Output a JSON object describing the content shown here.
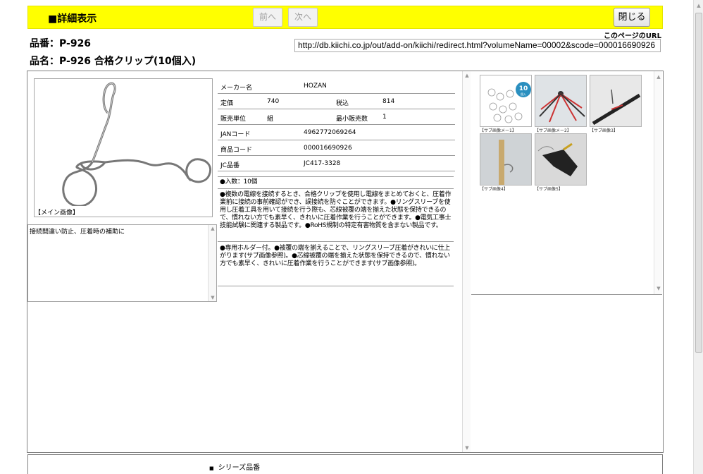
{
  "header": {
    "title": "■詳細表示",
    "prev": "前へ",
    "next": "次へ",
    "close": "閉じる"
  },
  "product": {
    "code": "品番：P-926",
    "name": "品名：P-926 合格クリップ(10個入)"
  },
  "url": {
    "label": "このページのURL",
    "value": "http://db.kiichi.co.jp/out/add-on/kiichi/redirect.html?volumeName=00002&scode=000016690926"
  },
  "main_image": {
    "caption": "【メイン画像】"
  },
  "description": "接続間違い防止、圧着時の補助に",
  "spec": {
    "maker_label": "メーカー名",
    "maker": "HOZAN",
    "list_price_label": "定価",
    "list_price": "740",
    "tax_label": "税込",
    "tax_price": "814",
    "unit_label": "販売単位",
    "unit": "組",
    "min_label": "最小販売数",
    "min": "1",
    "jan_label": "JANコード",
    "jan": "4962772069264",
    "item_label": "商品コード",
    "item": "000016690926",
    "jc_label": "JC品番",
    "jc": "JC417-3328"
  },
  "notes": {
    "qty": "●入数：10個",
    "p1": "●複数の電線を接続するとき、合格クリップを使用し電線をまとめておくと、圧着作業前に接続の事前確認ができ、誤接続を防ぐことができます。●リングスリーブを使用し圧着工具を用いて接続を行う際も、芯線被覆の端を揃えた状態を保持できるので、慣れない方でも素早く、きれいに圧着作業を行うことができます。●電気工事士技能試験に関連する製品です。●RoHS規制の特定有害物質を含まない製品です。",
    "p2": "●専用ホルダー付。●被覆の端を揃えることで、リングスリーブ圧着がきれいに仕上がります(サブ画像参照)。●芯線被覆の端を揃えた状態を保持できるので、慣れない方でも素早く、きれいに圧着作業を行うことができます(サブ画像参照)。"
  },
  "thumbs": {
    "c1": "【サブ画像メー1】",
    "c2": "【サブ画像メー2】",
    "c3": "【サブ画像3】",
    "c4": "【サブ画像4】",
    "c5": "【サブ画像5】",
    "badge": "10",
    "badge_sub": "個入"
  },
  "series": "シリーズ品番"
}
